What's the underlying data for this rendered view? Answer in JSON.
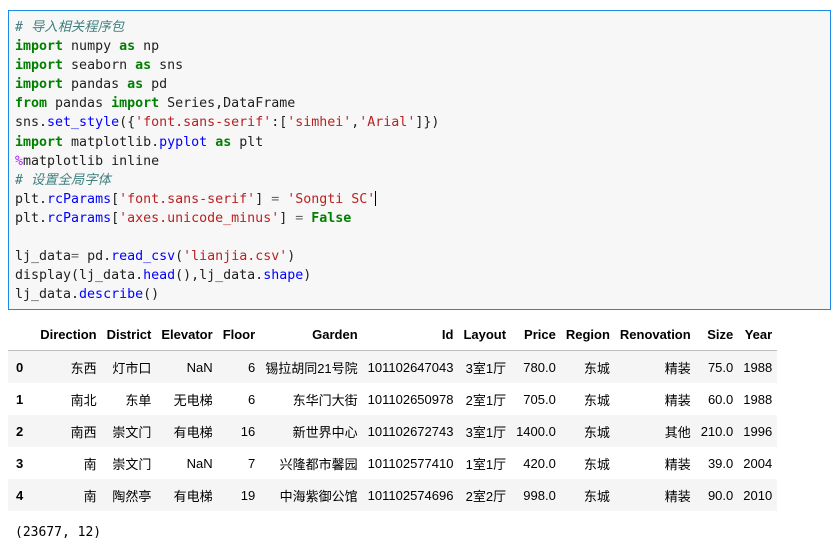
{
  "code": {
    "lines": [
      [
        [
          "c",
          "# 导入相关程序包"
        ]
      ],
      [
        [
          "k",
          "import"
        ],
        [
          "t",
          " numpy "
        ],
        [
          "k",
          "as"
        ],
        [
          "t",
          " np"
        ]
      ],
      [
        [
          "k",
          "import"
        ],
        [
          "t",
          " seaborn "
        ],
        [
          "k",
          "as"
        ],
        [
          "t",
          " sns"
        ]
      ],
      [
        [
          "k",
          "import"
        ],
        [
          "t",
          " pandas "
        ],
        [
          "k",
          "as"
        ],
        [
          "t",
          " pd"
        ]
      ],
      [
        [
          "k",
          "from"
        ],
        [
          "t",
          " pandas "
        ],
        [
          "k",
          "import"
        ],
        [
          "t",
          " Series,DataFrame"
        ]
      ],
      [
        [
          "t",
          "sns."
        ],
        [
          "f",
          "set_style"
        ],
        [
          "t",
          "({"
        ],
        [
          "s",
          "'font.sans-serif'"
        ],
        [
          "t",
          ":["
        ],
        [
          "s",
          "'simhei'"
        ],
        [
          "t",
          ","
        ],
        [
          "s",
          "'Arial'"
        ],
        [
          "t",
          "]})"
        ]
      ],
      [
        [
          "k",
          "import"
        ],
        [
          "t",
          " matplotlib."
        ],
        [
          "f",
          "pyplot"
        ],
        [
          "t",
          " "
        ],
        [
          "k",
          "as"
        ],
        [
          "t",
          " plt"
        ]
      ],
      [
        [
          "m",
          "%"
        ],
        [
          "t",
          "matplotlib inline"
        ]
      ],
      [
        [
          "c",
          "# 设置全局字体"
        ]
      ],
      [
        [
          "t",
          "plt."
        ],
        [
          "f",
          "rcParams"
        ],
        [
          "t",
          "["
        ],
        [
          "s",
          "'font.sans-serif'"
        ],
        [
          "t",
          "] "
        ],
        [
          "o",
          "="
        ],
        [
          "t",
          " "
        ],
        [
          "s",
          "'Songti SC'"
        ],
        [
          "caret",
          ""
        ]
      ],
      [
        [
          "t",
          "plt."
        ],
        [
          "f",
          "rcParams"
        ],
        [
          "t",
          "["
        ],
        [
          "s",
          "'axes.unicode_minus'"
        ],
        [
          "t",
          "] "
        ],
        [
          "o",
          "="
        ],
        [
          "t",
          " "
        ],
        [
          "k",
          "False"
        ]
      ],
      [],
      [
        [
          "t",
          "lj_data"
        ],
        [
          "o",
          "="
        ],
        [
          "t",
          " pd."
        ],
        [
          "f",
          "read_csv"
        ],
        [
          "t",
          "("
        ],
        [
          "s",
          "'lianjia.csv'"
        ],
        [
          "t",
          ")"
        ]
      ],
      [
        [
          "t",
          "display(lj_data."
        ],
        [
          "f",
          "head"
        ],
        [
          "t",
          "(),lj_data."
        ],
        [
          "f",
          "shape"
        ],
        [
          "t",
          ")"
        ]
      ],
      [
        [
          "t",
          "lj_data."
        ],
        [
          "f",
          "describe"
        ],
        [
          "t",
          "()"
        ]
      ]
    ]
  },
  "output": {
    "columns": [
      "",
      "Direction",
      "District",
      "Elevator",
      "Floor",
      "Garden",
      "Id",
      "Layout",
      "Price",
      "Region",
      "Renovation",
      "Size",
      "Year"
    ],
    "rows": [
      [
        "0",
        "东西",
        "灯市口",
        "NaN",
        "6",
        "锡拉胡同21号院",
        "101102647043",
        "3室1厅",
        "780.0",
        "东城",
        "精装",
        "75.0",
        "1988"
      ],
      [
        "1",
        "南北",
        "东单",
        "无电梯",
        "6",
        "东华门大街",
        "101102650978",
        "2室1厅",
        "705.0",
        "东城",
        "精装",
        "60.0",
        "1988"
      ],
      [
        "2",
        "南西",
        "崇文门",
        "有电梯",
        "16",
        "新世界中心",
        "101102672743",
        "3室1厅",
        "1400.0",
        "东城",
        "其他",
        "210.0",
        "1996"
      ],
      [
        "3",
        "南",
        "崇文门",
        "NaN",
        "7",
        "兴隆都市馨园",
        "101102577410",
        "1室1厅",
        "420.0",
        "东城",
        "精装",
        "39.0",
        "2004"
      ],
      [
        "4",
        "南",
        "陶然亭",
        "有电梯",
        "19",
        "中海紫御公馆",
        "101102574696",
        "2室2厅",
        "998.0",
        "东城",
        "精装",
        "90.0",
        "2010"
      ]
    ],
    "shape": "(23677, 12)"
  }
}
